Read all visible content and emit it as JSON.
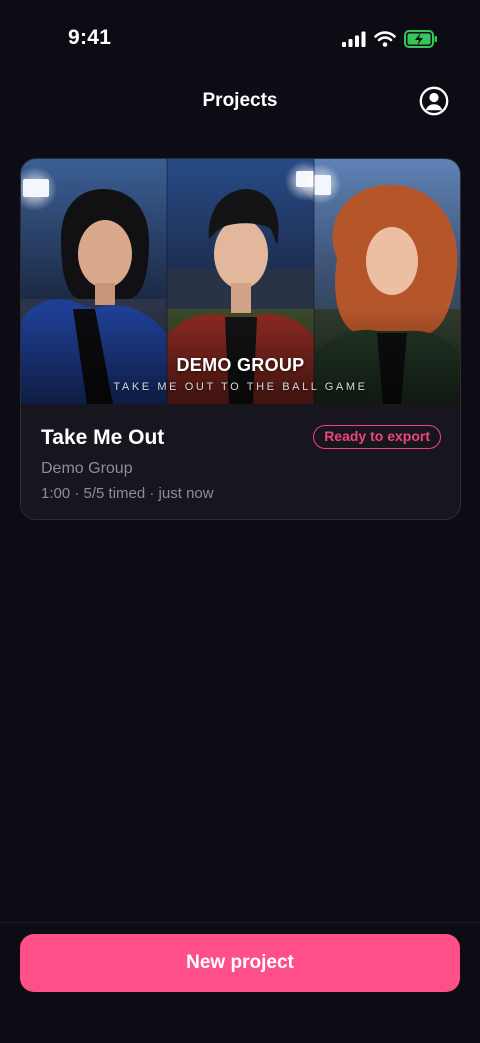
{
  "status_bar": {
    "time": "9:41",
    "icons": [
      "cellular-signal-icon",
      "wifi-icon",
      "battery-charging-icon"
    ]
  },
  "nav": {
    "title": "Projects",
    "profile_icon": "person-circle-icon"
  },
  "projects": [
    {
      "title": "Take Me Out",
      "status": "Ready to export",
      "group": "Demo Group",
      "meta": "1:00 · 5/5 timed · just now",
      "cover": {
        "title": "DEMO GROUP",
        "subtitle": "TAKE ME OUT TO THE BALL GAME"
      }
    }
  ],
  "actions": {
    "new_project_label": "New project"
  },
  "colors": {
    "background": "#0d0c14",
    "card": "#17161f",
    "accent": "#ff4f88",
    "badge": "#f0437d",
    "battery": "#34c759",
    "muted_text": "#8d8c98"
  }
}
